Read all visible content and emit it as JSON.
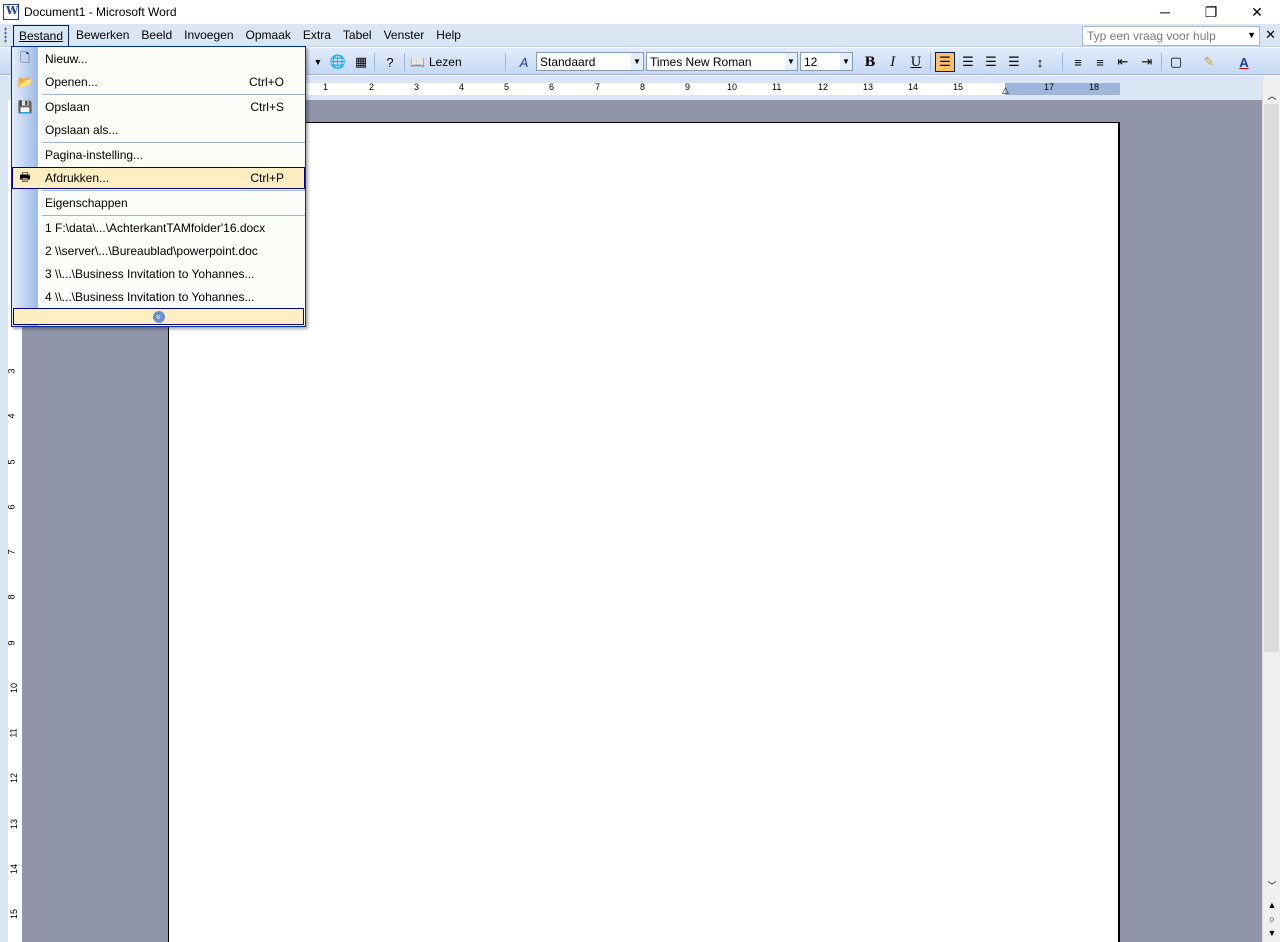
{
  "window": {
    "title": "Document1 - Microsoft Word",
    "minimize": "─",
    "restore": "❐",
    "close": "✕"
  },
  "menubar": {
    "items": [
      "Bestand",
      "Bewerken",
      "Beeld",
      "Invoegen",
      "Opmaak",
      "Extra",
      "Tabel",
      "Venster",
      "Help"
    ],
    "help_placeholder": "Typ een vraag voor hulp",
    "doc_close": "✕"
  },
  "toolbar": {
    "read_label": "Lezen",
    "style": "Standaard",
    "font": "Times New Roman",
    "size": "12",
    "bold": "B",
    "italic": "I",
    "underline": "U"
  },
  "ruler": {
    "h_ticks": [
      "1",
      "2",
      "3",
      "4",
      "5",
      "6",
      "7",
      "8",
      "9",
      "10",
      "11",
      "12",
      "13",
      "14",
      "15",
      "17",
      "18"
    ],
    "v_ticks": [
      "3",
      "4",
      "5",
      "6",
      "7",
      "8",
      "9",
      "10",
      "11",
      "12",
      "13",
      "14",
      "15"
    ]
  },
  "file_menu": {
    "items": [
      {
        "label": "Nieuw...",
        "shortcut": "",
        "icon": "new-doc-icon"
      },
      {
        "label": "Openen...",
        "shortcut": "Ctrl+O",
        "icon": "folder-open-icon"
      },
      {
        "label": "Opslaan",
        "shortcut": "Ctrl+S",
        "icon": "save-icon"
      },
      {
        "label": "Opslaan als...",
        "shortcut": "",
        "icon": ""
      },
      {
        "label": "Pagina-instelling...",
        "shortcut": "",
        "icon": ""
      },
      {
        "label": "Afdrukken...",
        "shortcut": "Ctrl+P",
        "icon": "printer-icon"
      },
      {
        "label": "Eigenschappen",
        "shortcut": "",
        "icon": ""
      },
      {
        "label": "1 F:\\data\\...\\AchterkantTAMfolder'16.docx",
        "shortcut": "",
        "icon": ""
      },
      {
        "label": "2 \\\\server\\...\\Bureaublad\\powerpoint.doc",
        "shortcut": "",
        "icon": ""
      },
      {
        "label": "3 \\\\...\\Business Invitation to Yohannes...",
        "shortcut": "",
        "icon": ""
      },
      {
        "label": "4 \\\\...\\Business Invitation to Yohannes...",
        "shortcut": "",
        "icon": ""
      }
    ],
    "hovered": "Afdrukken..."
  }
}
